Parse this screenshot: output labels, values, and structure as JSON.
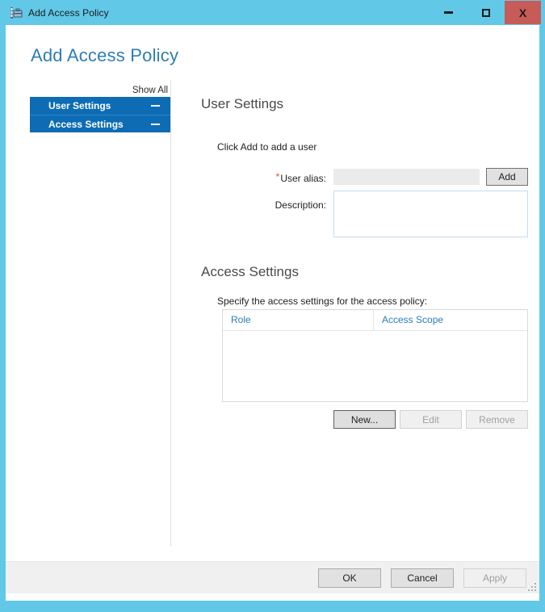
{
  "window": {
    "title": "Add Access Policy",
    "icon": "policy-toolbox-icon",
    "frame_color": "#62c8e8",
    "controls": {
      "minimize": "minimize-icon",
      "maximize": "maximize-icon",
      "close": "X"
    }
  },
  "page": {
    "heading": "Add Access Policy",
    "heading_color": "#2e7db5"
  },
  "nav": {
    "show_all": "Show All",
    "accent_color": "#0d6cb4",
    "items": [
      {
        "label": "User Settings",
        "collapse_glyph": "−",
        "expanded": true
      },
      {
        "label": "Access Settings",
        "collapse_glyph": "−",
        "expanded": true
      }
    ]
  },
  "user_settings": {
    "title": "User Settings",
    "hint": "Click Add to add a user",
    "alias_label": "User alias:",
    "alias_required_marker": "*",
    "alias_value": "",
    "alias_placeholder": "",
    "add_button": "Add",
    "description_label": "Description:",
    "description_value": "",
    "description_placeholder": ""
  },
  "access_settings": {
    "title": "Access Settings",
    "hint": "Specify the access settings for the access policy:",
    "columns": [
      "Role",
      "Access Scope"
    ],
    "column_color": "#2e7db5",
    "rows": [],
    "buttons": [
      {
        "label": "New...",
        "state": "default"
      },
      {
        "label": "Edit",
        "state": "disabled"
      },
      {
        "label": "Remove",
        "state": "disabled"
      }
    ]
  },
  "footer": {
    "buttons": [
      {
        "label": "OK",
        "state": "enabled"
      },
      {
        "label": "Cancel",
        "state": "enabled"
      },
      {
        "label": "Apply",
        "state": "disabled"
      }
    ]
  }
}
